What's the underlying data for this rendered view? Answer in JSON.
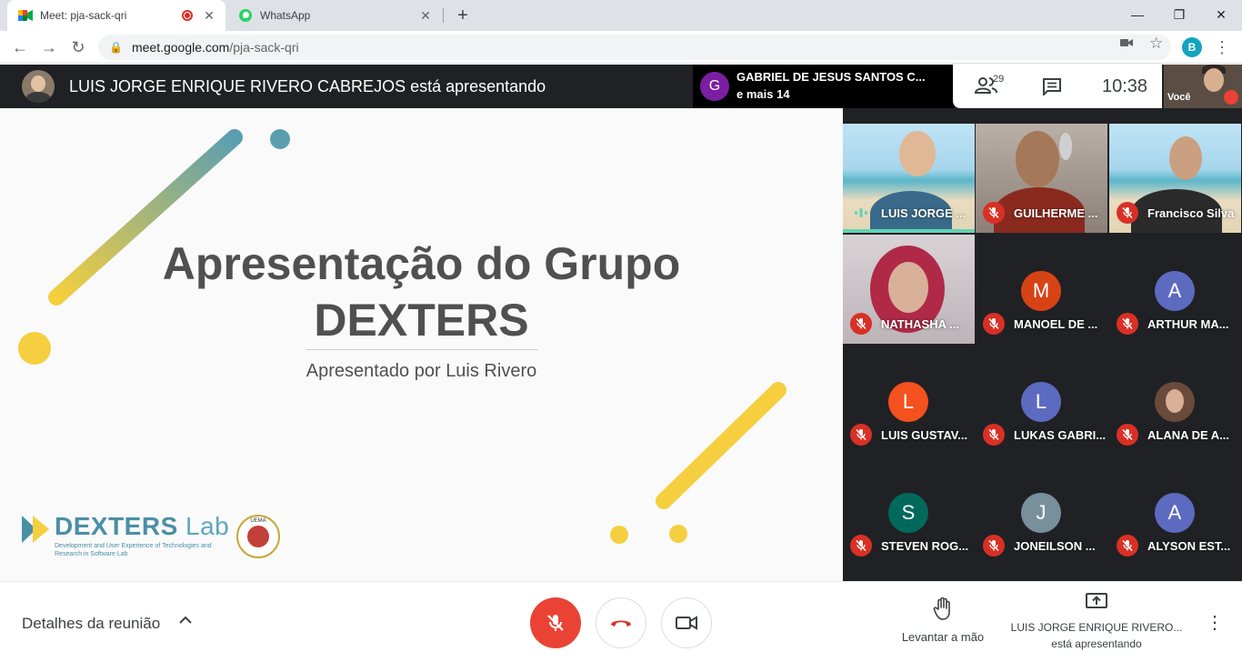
{
  "browser": {
    "tabs": [
      {
        "title": "Meet: pja-sack-qri",
        "active": true
      },
      {
        "title": "WhatsApp",
        "active": false
      }
    ],
    "url_host": "meet.google.com",
    "url_path": "/pja-sack-qri",
    "profile_initial": "B"
  },
  "meet": {
    "presenter_banner": "LUIS JORGE ENRIQUE RIVERO CABREJOS está apresentando",
    "active_speaker": {
      "initial": "G",
      "name": "GABRIEL DE JESUS SANTOS C...",
      "more": "e mais 14"
    },
    "participant_count": "29",
    "clock": "10:38",
    "self_label": "Você"
  },
  "slide": {
    "title_line1": "Apresentação do Grupo",
    "title_line2": "DEXTERS",
    "subtitle": "Apresentado por Luis Rivero",
    "logo_text": "DEXTERS",
    "logo_lab": "Lab",
    "logo_tagline": "Development and User Experience of Technologies and Research in Software Lab",
    "seal_text": "UEMA"
  },
  "participants": [
    {
      "name": "LUIS JORGE ...",
      "type": "video",
      "speaking": true
    },
    {
      "name": "GUILHERME ...",
      "type": "video",
      "speaking": false
    },
    {
      "name": "Francisco Silva",
      "type": "video",
      "speaking": false
    },
    {
      "name": "NATHASHA ...",
      "type": "video",
      "speaking": false
    },
    {
      "name": "MANOEL DE ...",
      "type": "avatar",
      "initial": "M",
      "color": "#d84315"
    },
    {
      "name": "ARTHUR MA...",
      "type": "avatar",
      "initial": "A",
      "color": "#5c6bc0"
    },
    {
      "name": "LUIS GUSTAV...",
      "type": "avatar",
      "initial": "L",
      "color": "#f4511e"
    },
    {
      "name": "LUKAS GABRI...",
      "type": "avatar",
      "initial": "L",
      "color": "#5c6bc0"
    },
    {
      "name": "ALANA DE A...",
      "type": "photo"
    },
    {
      "name": "STEVEN ROG...",
      "type": "avatar",
      "initial": "S",
      "color": "#00695c"
    },
    {
      "name": "JONEILSON ...",
      "type": "avatar",
      "initial": "J",
      "color": "#78909c"
    },
    {
      "name": "ALYSON EST...",
      "type": "avatar",
      "initial": "A",
      "color": "#5c6bc0"
    }
  ],
  "bottom": {
    "details_label": "Detalhes da reunião",
    "raise_hand_label": "Levantar a mão",
    "presenting_line1": "LUIS JORGE ENRIQUE RIVERO...",
    "presenting_line2": "está apresentando"
  },
  "colors": {
    "mic_off_red": "#ea4335",
    "speaking_teal": "#5fd3b8",
    "slide_yellow": "#f5cf3f",
    "slide_teal": "#5b9eb0"
  },
  "icons": [
    "meet-favicon",
    "whatsapp-favicon",
    "recording-icon",
    "close-icon",
    "new-tab-icon",
    "back-icon",
    "forward-icon",
    "reload-icon",
    "lock-icon",
    "camera-icon",
    "star-icon",
    "people-icon",
    "chat-icon",
    "mic-off-icon",
    "hangup-icon",
    "video-icon",
    "raise-hand-icon",
    "present-icon",
    "more-icon"
  ]
}
